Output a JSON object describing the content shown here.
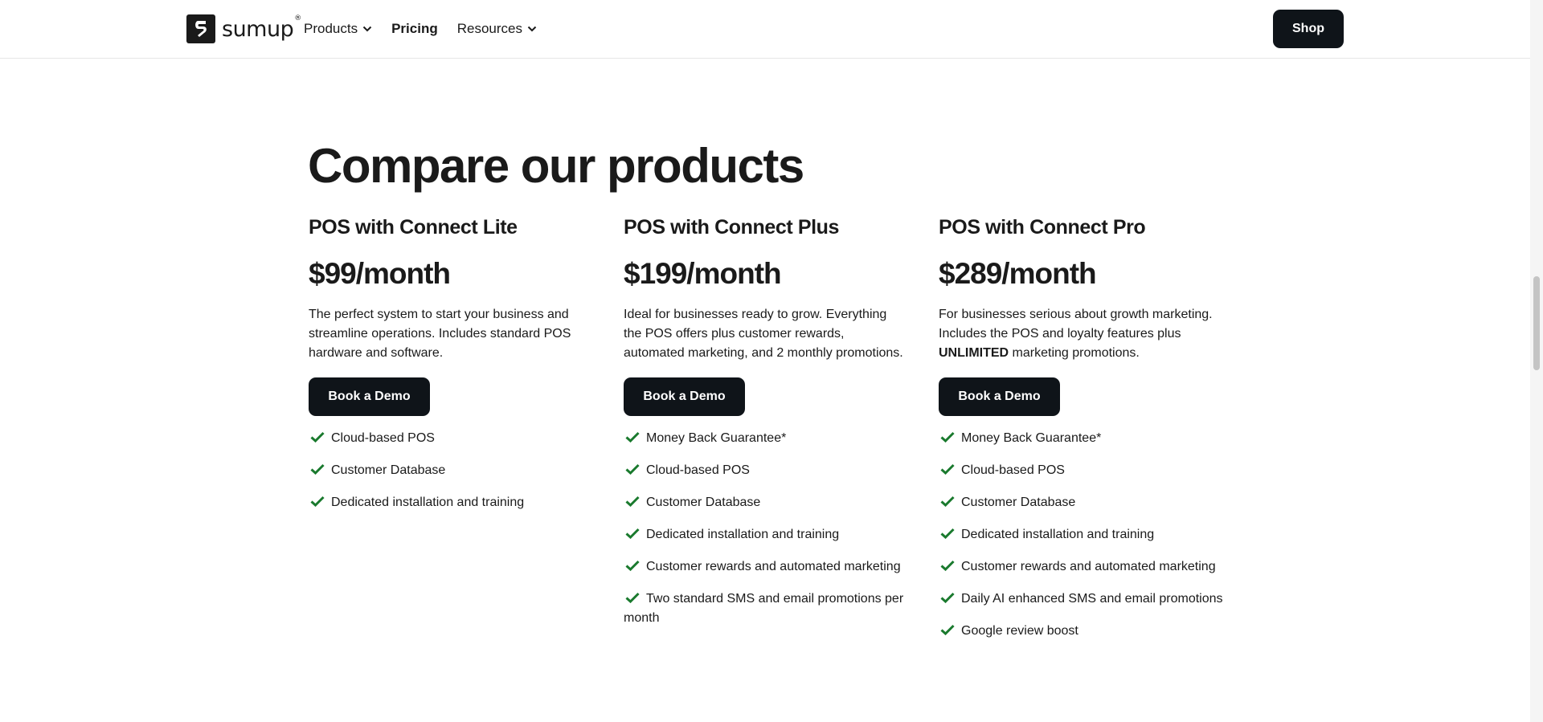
{
  "header": {
    "logo_text": "sumup",
    "logo_reg": "®",
    "nav": [
      {
        "label": "Products",
        "has_dropdown": true
      },
      {
        "label": "Pricing",
        "has_dropdown": false
      },
      {
        "label": "Resources",
        "has_dropdown": true
      }
    ],
    "shop_label": "Shop"
  },
  "main": {
    "title": "Compare our products",
    "plans": [
      {
        "name": "POS with Connect Lite",
        "price": "$99/month",
        "description": "The perfect system to start your business and streamline operations. Includes standard POS hardware and software.",
        "cta": "Book a Demo",
        "features": [
          "Cloud-based POS",
          "Customer Database",
          "Dedicated installation and training"
        ]
      },
      {
        "name": "POS with Connect Plus",
        "price": "$199/month",
        "description": "Ideal for businesses ready to grow. Everything the POS offers plus customer rewards, automated marketing, and 2 monthly promotions.",
        "cta": "Book a Demo",
        "features": [
          "Money Back Guarantee*",
          "Cloud-based POS",
          "Customer Database",
          "Dedicated installation and training",
          "Customer rewards and automated marketing",
          "Two standard SMS and email promotions per month"
        ]
      },
      {
        "name": "POS with Connect Pro",
        "price": "$289/month",
        "description_pre": "For businesses serious about growth marketing. Includes the POS and loyalty features plus ",
        "description_bold": "UNLIMITED",
        "description_post": " marketing promotions.",
        "cta": "Book a Demo",
        "features": [
          "Money Back Guarantee*",
          "Cloud-based POS",
          "Customer Database",
          "Dedicated installation and training",
          "Customer rewards and automated marketing",
          "Daily AI enhanced SMS and email promotions",
          "Google review boost"
        ]
      }
    ]
  },
  "colors": {
    "button_bg": "#0f1419",
    "check_green": "#1a7a2e",
    "text": "#1a1a1a"
  },
  "icons": {
    "nav_dropdown": "chevron-down-icon",
    "feature": "checkmark-icon"
  }
}
